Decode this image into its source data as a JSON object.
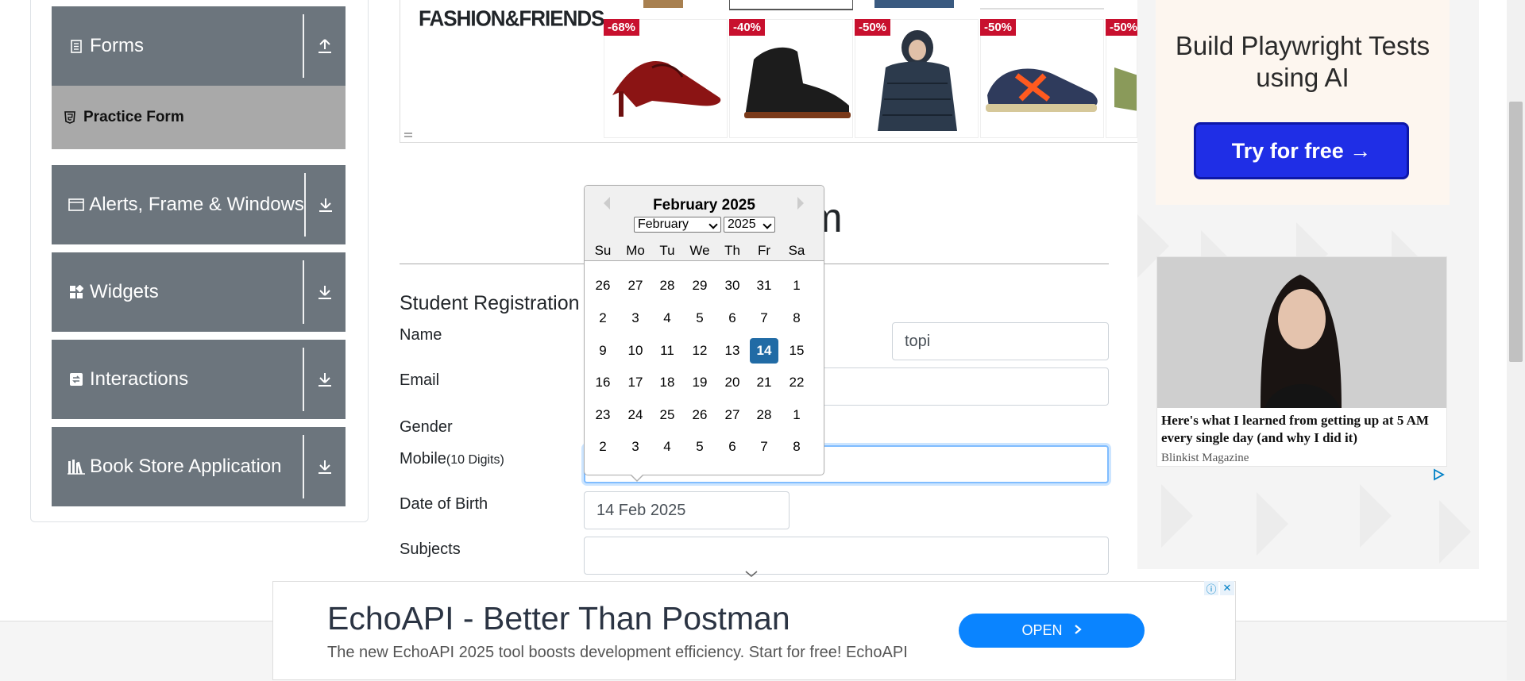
{
  "sidebar": {
    "groups": [
      {
        "label": "Forms",
        "icon": "document-icon",
        "arrow": "upload-icon"
      },
      {
        "label": "Alerts, Frame & Windows",
        "icon": "window-icon",
        "arrow": "download-icon"
      },
      {
        "label": "Widgets",
        "icon": "widgets-icon",
        "arrow": "download-icon"
      },
      {
        "label": "Interactions",
        "icon": "interactions-icon",
        "arrow": "download-icon"
      },
      {
        "label": "Book Store Application",
        "icon": "books-icon",
        "arrow": "download-icon"
      }
    ],
    "active_item": {
      "label": "Practice Form",
      "icon": "html5-icon"
    }
  },
  "top_ad": {
    "brand": "FASHION&FRIENDS",
    "tiles": [
      {
        "discount": "-68%",
        "product": "red slingback heel"
      },
      {
        "discount": "-40%",
        "product": "black high-top sneaker"
      },
      {
        "discount": "-50%",
        "product": "puffer jacket"
      },
      {
        "discount": "-50%",
        "product": "running sneaker"
      },
      {
        "discount": "-50%",
        "product": "sneaker"
      }
    ]
  },
  "form": {
    "page_title_partial": "rm",
    "section_title": "Student Registration",
    "labels": {
      "name": "Name",
      "email": "Email",
      "gender": "Gender",
      "mobile": "Mobile",
      "mobile_hint": "(10 Digits)",
      "dob": "Date of Birth",
      "subjects": "Subjects"
    },
    "values": {
      "last_name": "topi",
      "dob": "14 Feb 2025",
      "mobile": "",
      "subjects": ""
    }
  },
  "datepicker": {
    "header": "February 2025",
    "month_select": "February",
    "year_select": "2025",
    "weekdays": [
      "Su",
      "Mo",
      "Tu",
      "We",
      "Th",
      "Fr",
      "Sa"
    ],
    "weeks": [
      [
        "26",
        "27",
        "28",
        "29",
        "30",
        "31",
        "1"
      ],
      [
        "2",
        "3",
        "4",
        "5",
        "6",
        "7",
        "8"
      ],
      [
        "9",
        "10",
        "11",
        "12",
        "13",
        "14",
        "15"
      ],
      [
        "16",
        "17",
        "18",
        "19",
        "20",
        "21",
        "22"
      ],
      [
        "23",
        "24",
        "25",
        "26",
        "27",
        "28",
        "1"
      ],
      [
        "2",
        "3",
        "4",
        "5",
        "6",
        "7",
        "8"
      ]
    ],
    "selected_day": "14"
  },
  "right_ad": {
    "title": "Build Playwright Tests using AI",
    "button": "Try for free →",
    "news_title": "Here's what I learned from getting up at 5 AM every single day (and why I did it)",
    "news_source": "Blinkist Magazine"
  },
  "bottom_ad": {
    "title": "EchoAPI - Better Than Postman",
    "subtitle": "The new EchoAPI 2025 tool boosts development efficiency. Start for free! EchoAPI",
    "button": "OPEN"
  },
  "colors": {
    "sidebar_group": "#6c757d",
    "sidebar_active": "#a9a9a9",
    "selected_day": "#216ba5",
    "cta_blue": "#1f2ee6",
    "open_btn": "#0a84ff",
    "discount": "#c8102e"
  }
}
